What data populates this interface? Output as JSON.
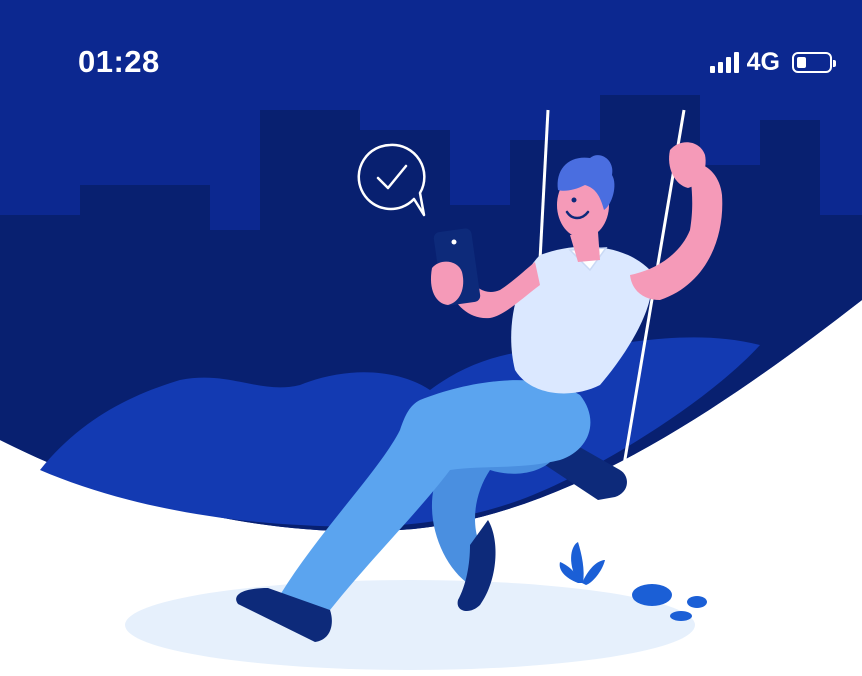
{
  "status_bar": {
    "time": "01:28",
    "network": "4G",
    "signal_bars": 4,
    "battery_level": 0.3
  },
  "illustration": {
    "description_icon": "person-on-swing-with-phone",
    "icons": [
      "checkmark-speech-bubble-icon",
      "smartphone-icon",
      "plant-icon",
      "stones-icon"
    ]
  },
  "colors": {
    "background_top": "#0c2890",
    "skyline": "#082070",
    "hills": "#133ab2",
    "skin": "#f59ab8",
    "shirt": "#dbe8ff",
    "pants": "#5ba4ef",
    "shoes": "#0d2a7a",
    "ground_shadow": "#e6f0fc",
    "accent": "#1b5fd6"
  }
}
